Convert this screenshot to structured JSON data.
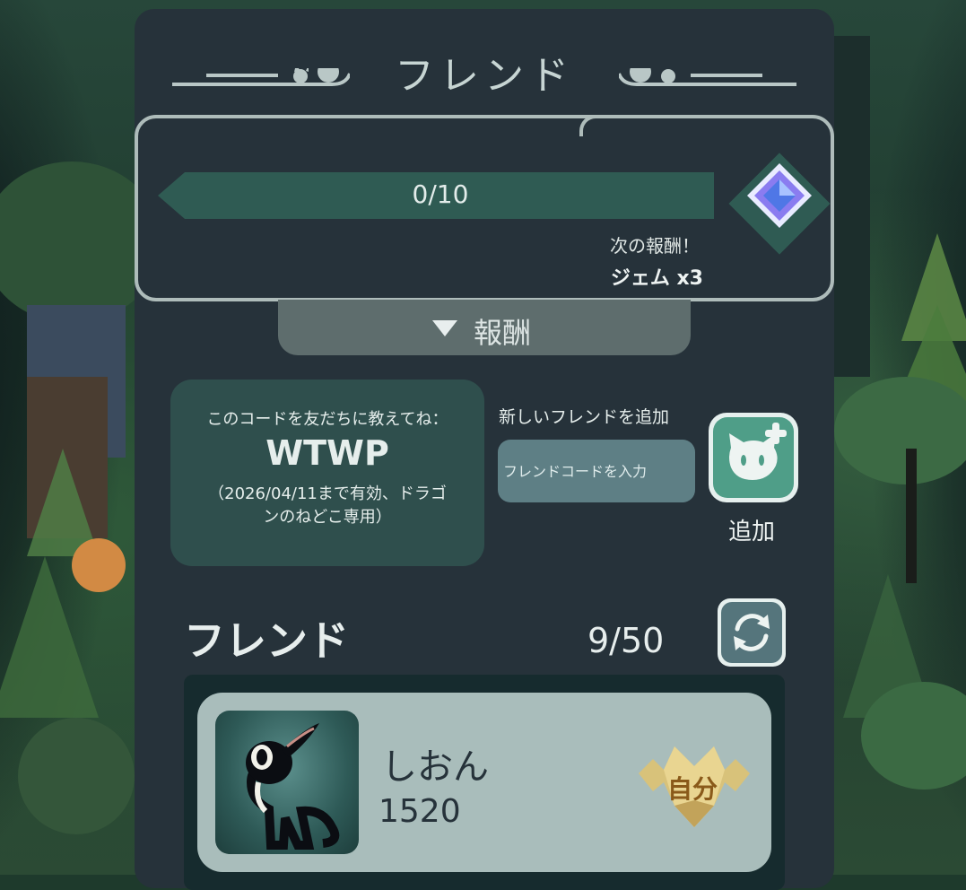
{
  "header": {
    "title": "フレンド"
  },
  "reward": {
    "progress_text": "0/10",
    "progress_value": 0,
    "progress_max": 10,
    "next_label": "次の報酬！",
    "next_value": "ジェム x3",
    "tab_label": "報酬",
    "gem_icon": "gem-icon"
  },
  "code_card": {
    "hint": "このコードを友だちに教えてね：",
    "code": "WTWP",
    "valid_note": "（2026/04/11まで有効、ドラゴンのねどこ専用）"
  },
  "add_friend": {
    "label": "新しいフレンドを追加",
    "input_placeholder": "フレンドコードを入力",
    "input_value": "",
    "button_label": "追加"
  },
  "friends": {
    "title": "フレンド",
    "count": "9/50",
    "items": [
      {
        "name": "しおん",
        "score": "1520",
        "badge": "自分"
      }
    ]
  },
  "colors": {
    "panel": "#26323a",
    "accent_green": "#4f9e88",
    "progress_fill": "#2f5b53",
    "card": "#a9bdbb",
    "badge_gold": "#d8c27a"
  }
}
